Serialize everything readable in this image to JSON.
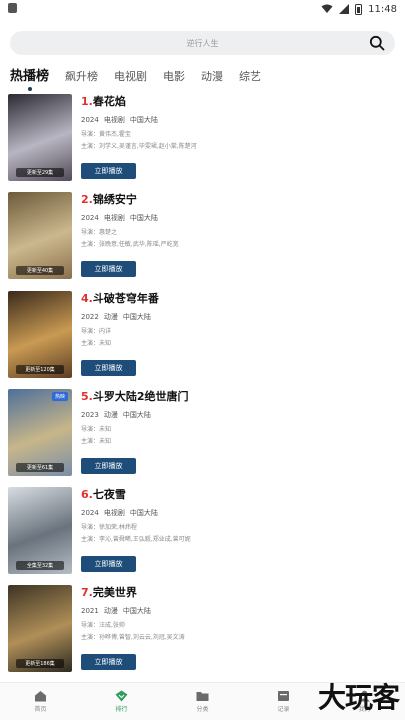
{
  "status_bar": {
    "time": "11:48"
  },
  "search": {
    "placeholder": "逆行人生"
  },
  "tabs": [
    {
      "label": "热播榜",
      "active": true
    },
    {
      "label": "飙升榜"
    },
    {
      "label": "电视剧"
    },
    {
      "label": "电影"
    },
    {
      "label": "动漫"
    },
    {
      "label": "综艺"
    }
  ],
  "items": [
    {
      "rank": "1.",
      "title": "春花焰",
      "year": "2024",
      "type": "电视剧",
      "region": "中国大陆",
      "director": "导演：黄伟杰,霍宝",
      "cast": "主演：刘学义,吴谨言,毕雯珺,赵小棠,陈楚河",
      "poster_text": "更新至29集",
      "poster_colors": [
        "#2b2a33",
        "#b8b6c2",
        "#534b57"
      ]
    },
    {
      "rank": "2.",
      "title": "锦绣安宁",
      "year": "2024",
      "type": "电视剧",
      "region": "中国大陆",
      "director": "导演：惠楚之",
      "cast": "主演：张晚意,任敏,武华,陈瑶,严屹宽",
      "poster_text": "更新至40集",
      "poster_colors": [
        "#6c5a3a",
        "#cbb88e",
        "#8a6f4c"
      ]
    },
    {
      "rank": "4.",
      "title": "斗破苍穹年番",
      "year": "2022",
      "type": "动漫",
      "region": "中国大陆",
      "director": "导演：内详",
      "cast": "主演：未知",
      "poster_text": "更新至120集",
      "poster_colors": [
        "#3a2a1c",
        "#c99a52",
        "#5b3e24"
      ]
    },
    {
      "rank": "5.",
      "title": "斗罗大陆2绝世唐门",
      "year": "2023",
      "type": "动漫",
      "region": "中国大陆",
      "director": "导演：未知",
      "cast": "主演：未知",
      "poster_text": "更新至61集",
      "poster_tag": "热映",
      "poster_colors": [
        "#4e6f9b",
        "#c7b689",
        "#7a8da8"
      ]
    },
    {
      "rank": "6.",
      "title": "七夜雪",
      "year": "2024",
      "type": "电视剧",
      "region": "中国大陆",
      "director": "导演：徐加荣,林炜程",
      "cast": "主演：李沁,曾舜晞,王弘毅,郑业成,曾可妮",
      "poster_text": "全集至32集",
      "poster_colors": [
        "#d8dde2",
        "#6a737d",
        "#b4bcc4"
      ]
    },
    {
      "rank": "7.",
      "title": "完美世界",
      "year": "2021",
      "type": "动漫",
      "region": "中国大陆",
      "director": "导演：汪成,张帅",
      "cast": "主演：孙晔博,曾智,刘云云,刘冠,吴文涛",
      "poster_text": "更新至186集",
      "poster_colors": [
        "#3d3424",
        "#b08f58",
        "#2c2a22"
      ]
    }
  ],
  "play_label": "立即播放",
  "bottom_nav": [
    {
      "label": "首页",
      "icon": "home-icon"
    },
    {
      "label": "排行",
      "icon": "ranking-icon",
      "active": true
    },
    {
      "label": "分类",
      "icon": "folder-icon"
    },
    {
      "label": "记录",
      "icon": "history-icon"
    },
    {
      "label": "我的",
      "icon": "user-icon"
    }
  ],
  "watermark": "大玩客",
  "colors": {
    "accent": "#1e4d7a",
    "rank_red": "#e0312f",
    "nav_active": "#2f9e5c"
  }
}
